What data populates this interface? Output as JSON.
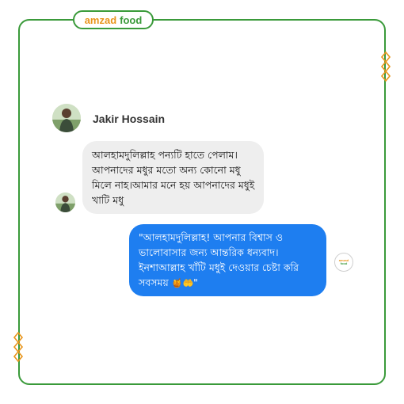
{
  "brand": {
    "name_part1": "amzad",
    "name_part2": "food"
  },
  "user": {
    "name": "Jakir Hossain"
  },
  "messages": {
    "incoming": {
      "text": "আলহামদুলিল্লাহ পন্যটি হাতে পেলাম।আপনাদের মধুর মতো অন্য কোনো মধু মিলে নাহ।আমার মনে হয় আপনাদের মধুই খাটি মধু"
    },
    "outgoing": {
      "text": "\"আলহামদুলিল্লাহ! আপনার বিশ্বাস ও ভালোবাসার জন্য আন্তরিক ধন্যবাদ। ইনশাআল্লাহ খাঁটি মধুই দেওয়ার চেষ্টা করি সবসময়",
      "emoji": "🍯🤲",
      "end_quote": "\""
    }
  },
  "colors": {
    "frame": "#3a9a3a",
    "brand_orange": "#e8941a",
    "outgoing_bubble": "#1e7ef0",
    "incoming_bubble": "#eeeeee"
  },
  "icons": {
    "frame_ornament": "diamond-chain-icon",
    "avatar": "user-photo-avatar"
  }
}
